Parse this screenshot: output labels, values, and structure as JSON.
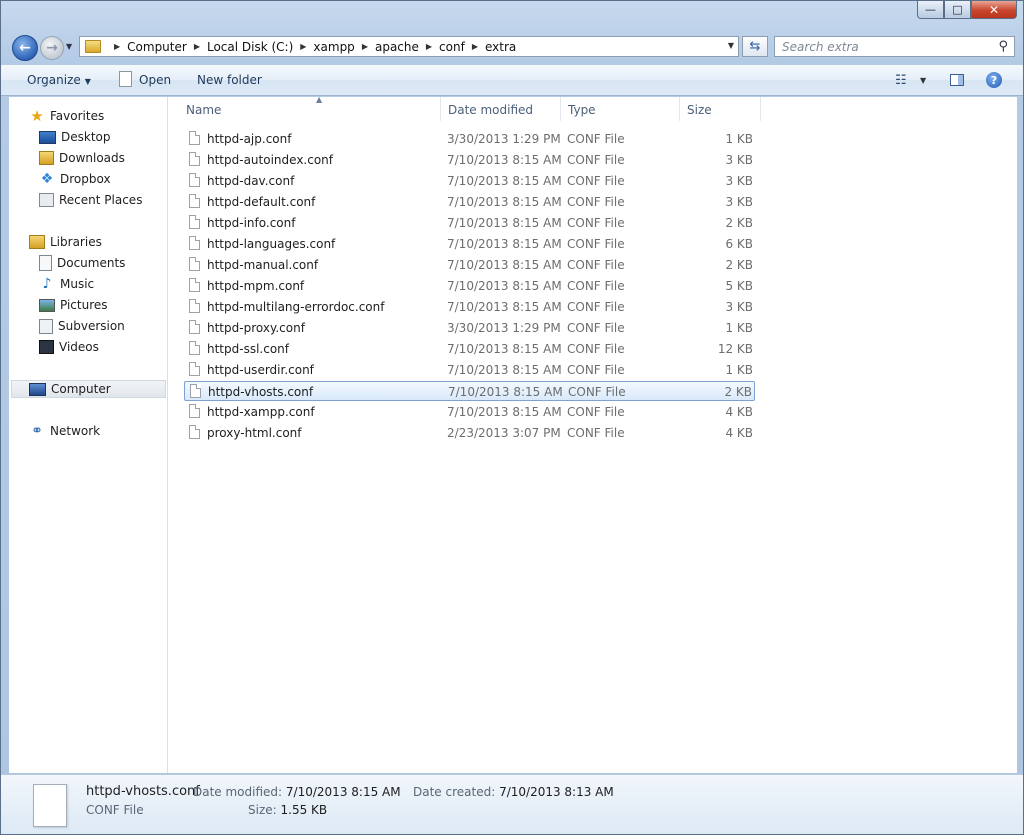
{
  "window": {
    "min_label": "—",
    "max_label": "□",
    "close_label": "✕"
  },
  "address": {
    "crumbs": [
      "Computer",
      "Local Disk (C:)",
      "xampp",
      "apache",
      "conf",
      "extra"
    ],
    "search_placeholder": "Search extra"
  },
  "toolbar": {
    "organize_label": "Organize",
    "open_label": "Open",
    "new_folder_label": "New folder",
    "help_label": "?"
  },
  "sidebar": {
    "favorites_label": "Favorites",
    "favorites": [
      "Desktop",
      "Downloads",
      "Dropbox",
      "Recent Places"
    ],
    "libraries_label": "Libraries",
    "libraries": [
      "Documents",
      "Music",
      "Pictures",
      "Subversion",
      "Videos"
    ],
    "computer_label": "Computer",
    "network_label": "Network"
  },
  "columns": {
    "name": "Name",
    "date": "Date modified",
    "type": "Type",
    "size": "Size"
  },
  "files": [
    {
      "name": "httpd-ajp.conf",
      "date": "3/30/2013 1:29 PM",
      "type": "CONF File",
      "size": "1 KB"
    },
    {
      "name": "httpd-autoindex.conf",
      "date": "7/10/2013 8:15 AM",
      "type": "CONF File",
      "size": "3 KB"
    },
    {
      "name": "httpd-dav.conf",
      "date": "7/10/2013 8:15 AM",
      "type": "CONF File",
      "size": "3 KB"
    },
    {
      "name": "httpd-default.conf",
      "date": "7/10/2013 8:15 AM",
      "type": "CONF File",
      "size": "3 KB"
    },
    {
      "name": "httpd-info.conf",
      "date": "7/10/2013 8:15 AM",
      "type": "CONF File",
      "size": "2 KB"
    },
    {
      "name": "httpd-languages.conf",
      "date": "7/10/2013 8:15 AM",
      "type": "CONF File",
      "size": "6 KB"
    },
    {
      "name": "httpd-manual.conf",
      "date": "7/10/2013 8:15 AM",
      "type": "CONF File",
      "size": "2 KB"
    },
    {
      "name": "httpd-mpm.conf",
      "date": "7/10/2013 8:15 AM",
      "type": "CONF File",
      "size": "5 KB"
    },
    {
      "name": "httpd-multilang-errordoc.conf",
      "date": "7/10/2013 8:15 AM",
      "type": "CONF File",
      "size": "3 KB"
    },
    {
      "name": "httpd-proxy.conf",
      "date": "3/30/2013 1:29 PM",
      "type": "CONF File",
      "size": "1 KB"
    },
    {
      "name": "httpd-ssl.conf",
      "date": "7/10/2013 8:15 AM",
      "type": "CONF File",
      "size": "12 KB"
    },
    {
      "name": "httpd-userdir.conf",
      "date": "7/10/2013 8:15 AM",
      "type": "CONF File",
      "size": "1 KB"
    },
    {
      "name": "httpd-vhosts.conf",
      "date": "7/10/2013 8:15 AM",
      "type": "CONF File",
      "size": "2 KB",
      "selected": true
    },
    {
      "name": "httpd-xampp.conf",
      "date": "7/10/2013 8:15 AM",
      "type": "CONF File",
      "size": "4 KB"
    },
    {
      "name": "proxy-html.conf",
      "date": "2/23/2013 3:07 PM",
      "type": "CONF File",
      "size": "4 KB"
    }
  ],
  "details": {
    "name": "httpd-vhosts.conf",
    "type": "CONF File",
    "modified_label": "Date modified:",
    "modified_value": "7/10/2013 8:15 AM",
    "created_label": "Date created:",
    "created_value": "7/10/2013 8:13 AM",
    "size_label": "Size:",
    "size_value": "1.55 KB"
  },
  "colors": {
    "selection_border": "#7da2ce",
    "accent": "#1e395b"
  }
}
